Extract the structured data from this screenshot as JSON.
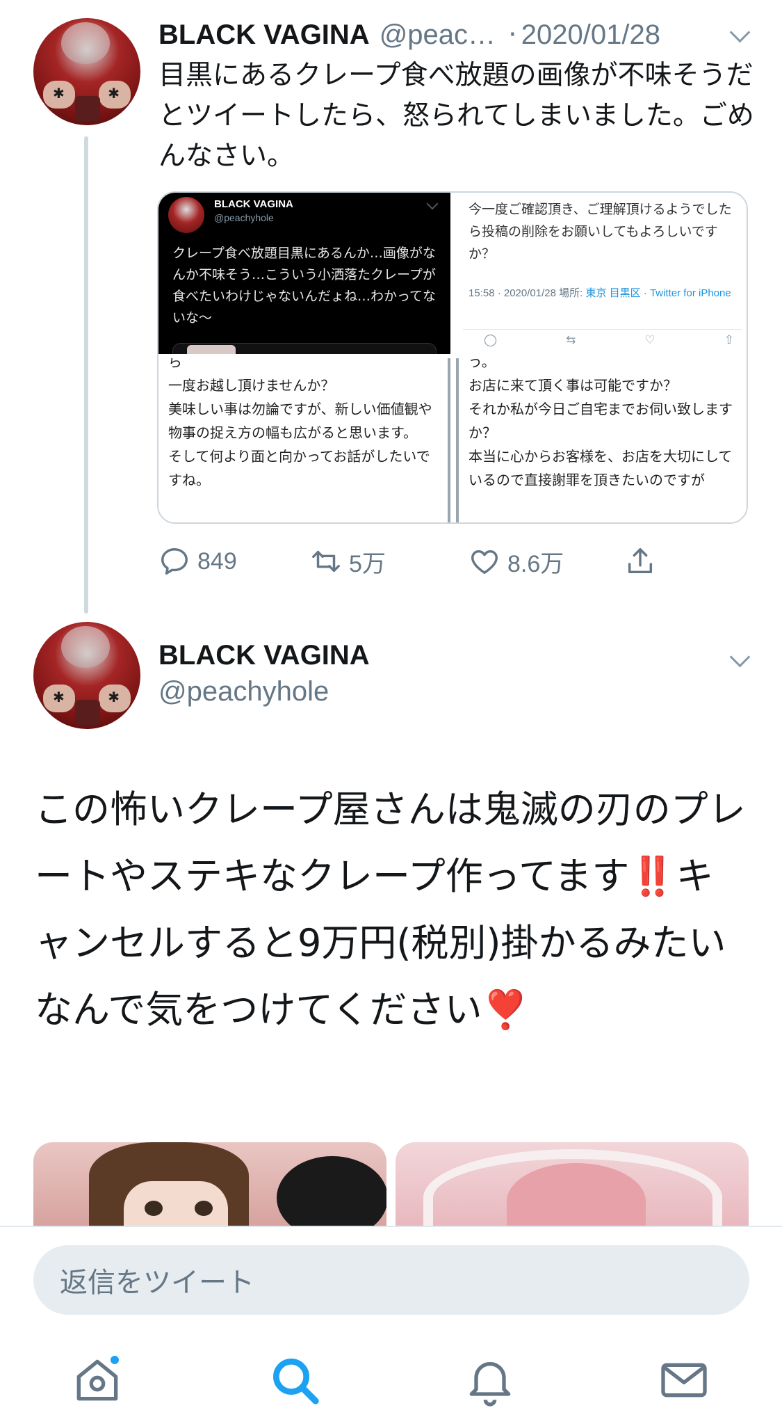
{
  "tweet1": {
    "author_name": "BLACK VAGINA",
    "author_handle": "@peac…",
    "separator": "·",
    "date": "2020/01/28",
    "text": "目黒にあるクレープ食べ放題の画像が不味そうだとツイートしたら、怒られてしまいました。ごめんなさい。",
    "media": {
      "top_left": {
        "name": "BLACK VAGINA",
        "handle": "@peachyhole",
        "text": "クレープ食べ放題目黒にあるんか…画像がなんか不味そう…こういう小洒落たクレープが食べたいわけじゃないんだょね…わかってないな〜"
      },
      "top_right": {
        "text": "今一度ご確認頂き、ご理解頂けるようでしたら投稿の削除をお願いしてもよろしいですか？",
        "meta_time": "15:58 · 2020/01/28 場所: ",
        "meta_place": "東京 目黒区",
        "meta_sep": " · ",
        "meta_source": "Twitter for iPhone"
      },
      "bottom_left": {
        "text": "ら\n一度お越し頂けませんか？\n美味しい事は勿論ですが、新しい価値観や物事の捉え方の幅も広がると思います。\nそして何より面と向かってお話がしたいですね。"
      },
      "bottom_right": {
        "text": "う。\nお店に来て頂く事は可能ですか？\nそれか私が今日ご自宅までお伺い致しますか？\n本当に心からお客様を、お店を大切にしているので直接謝罪を頂きたいのですが"
      }
    },
    "replies": "849",
    "retweets": "5万",
    "likes": "8.6万"
  },
  "tweet2": {
    "author_name": "BLACK VAGINA",
    "author_handle": "@peachyhole",
    "text_part1": "この怖いクレープ屋さんは鬼滅の刃のプレートやステキなクレープ作ってます",
    "emoji1": "‼️",
    "text_part2": "キャンセルすると9万円(税別)掛かるみたいなんで気をつけてください",
    "emoji2": "❣️"
  },
  "reply_placeholder": "返信をツイート",
  "colors": {
    "accent": "#1da1f2",
    "text_secondary": "#657786",
    "reply_bg": "#e6ecf0"
  },
  "icons": [
    "chevron-down-icon",
    "reply-icon",
    "retweet-icon",
    "like-icon",
    "share-icon",
    "home-icon",
    "search-icon",
    "notifications-icon",
    "messages-icon"
  ]
}
